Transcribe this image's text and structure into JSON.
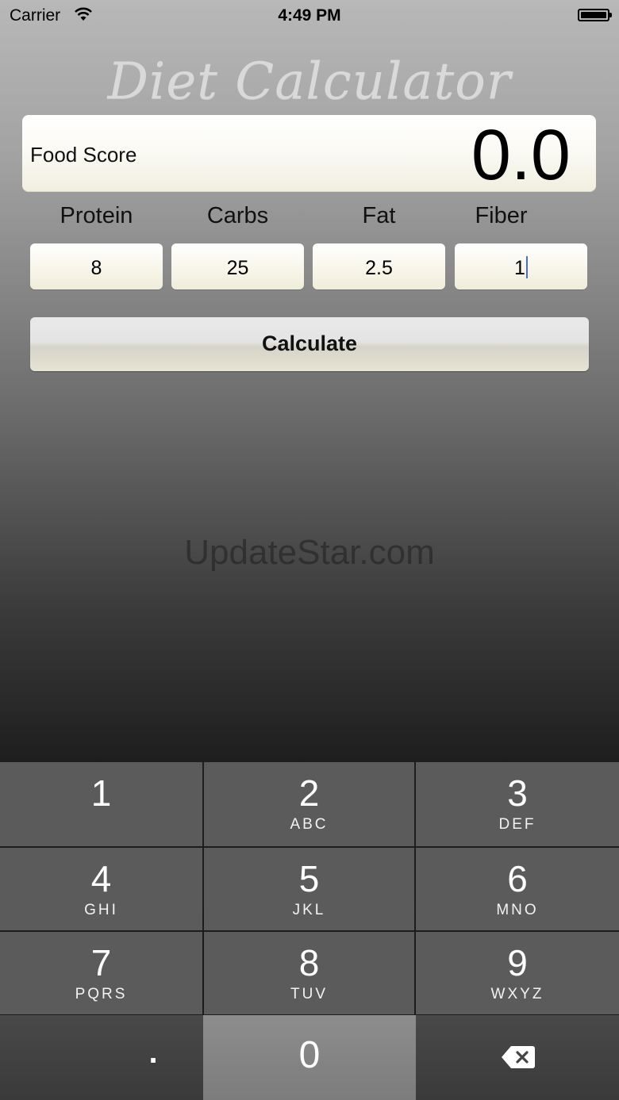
{
  "status_bar": {
    "carrier": "Carrier",
    "time": "4:49 PM"
  },
  "app": {
    "title": "Diet Calculator"
  },
  "score": {
    "label": "Food Score",
    "value": "0.0"
  },
  "nutrients": [
    {
      "label": "Protein",
      "value": "8"
    },
    {
      "label": "Carbs",
      "value": "25"
    },
    {
      "label": "Fat",
      "value": "2.5"
    },
    {
      "label": "Fiber",
      "value": "1"
    }
  ],
  "calculate_button": {
    "label": "Calculate"
  },
  "watermark": "UpdateStar.com",
  "keypad": {
    "keys": [
      {
        "digit": "1",
        "letters": ""
      },
      {
        "digit": "2",
        "letters": "ABC"
      },
      {
        "digit": "3",
        "letters": "DEF"
      },
      {
        "digit": "4",
        "letters": "GHI"
      },
      {
        "digit": "5",
        "letters": "JKL"
      },
      {
        "digit": "6",
        "letters": "MNO"
      },
      {
        "digit": "7",
        "letters": "PQRS"
      },
      {
        "digit": "8",
        "letters": "TUV"
      },
      {
        "digit": "9",
        "letters": "WXYZ"
      }
    ],
    "dot": ".",
    "zero": "0"
  }
}
